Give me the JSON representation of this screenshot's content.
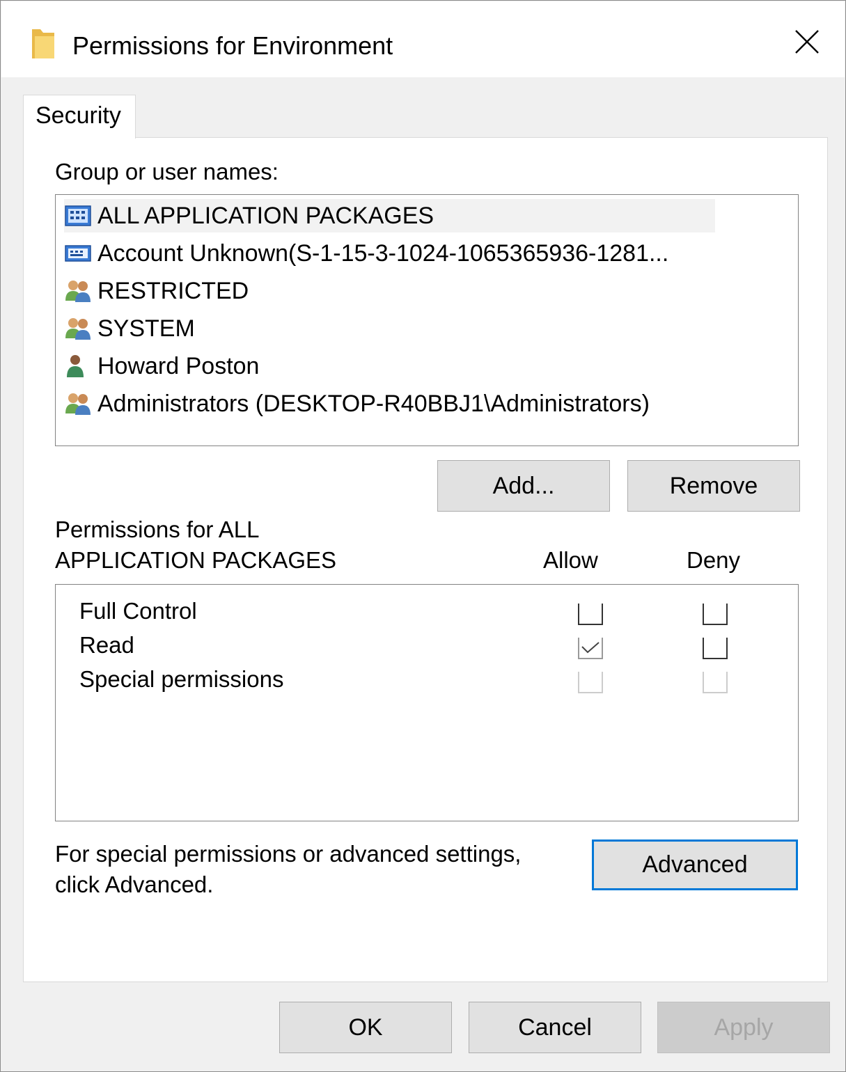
{
  "window": {
    "title": "Permissions for Environment"
  },
  "tabs": [
    {
      "label": "Security",
      "active": true
    }
  ],
  "group_label": "Group or user names:",
  "users": [
    {
      "name": "ALL APPLICATION PACKAGES",
      "icon": "app-package-icon",
      "selected": true
    },
    {
      "name": "Account Unknown(S-1-15-3-1024-1065365936-1281...",
      "icon": "unknown-account-icon",
      "selected": false
    },
    {
      "name": "RESTRICTED",
      "icon": "group-icon",
      "selected": false
    },
    {
      "name": "SYSTEM",
      "icon": "group-icon",
      "selected": false
    },
    {
      "name": "Howard Poston",
      "icon": "user-icon",
      "selected": false
    },
    {
      "name": "Administrators (DESKTOP-R40BBJ1\\Administrators)",
      "icon": "group-icon",
      "selected": false
    }
  ],
  "buttons": {
    "add": "Add...",
    "remove": "Remove",
    "advanced": "Advanced",
    "ok": "OK",
    "cancel": "Cancel",
    "apply": "Apply"
  },
  "permissions": {
    "header_line1": "Permissions for ALL",
    "header_line2": "APPLICATION PACKAGES",
    "allow_label": "Allow",
    "deny_label": "Deny",
    "rows": [
      {
        "name": "Full Control",
        "allow": false,
        "deny": false,
        "enabled": true
      },
      {
        "name": "Read",
        "allow": true,
        "deny": false,
        "enabled": true
      },
      {
        "name": "Special permissions",
        "allow": false,
        "deny": false,
        "enabled": false
      }
    ]
  },
  "advanced_hint_line1": "For special permissions or advanced settings,",
  "advanced_hint_line2": "click Advanced.",
  "colors": {
    "accent": "#0078d7",
    "folder": "#f8d775"
  }
}
